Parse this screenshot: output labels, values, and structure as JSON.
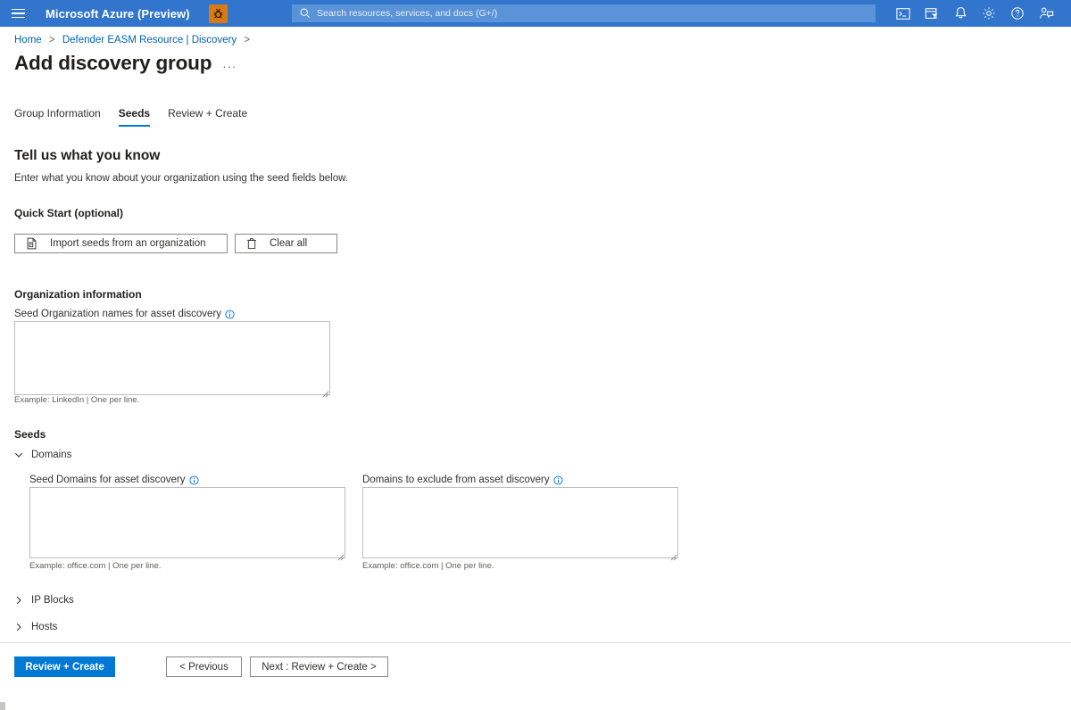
{
  "topbar": {
    "menu_icon": "hamburger-icon",
    "brand": "Microsoft Azure (Preview)",
    "bug_badge_icon": "bug-icon",
    "search": {
      "icon": "search-icon",
      "placeholder": "Search resources, services, and docs (G+/)",
      "value": ""
    },
    "icons": [
      {
        "name": "cloud-shell-icon",
        "label": "Cloud Shell"
      },
      {
        "name": "directory-filter-icon",
        "label": "Directories + subscriptions"
      },
      {
        "name": "notifications-bell-icon",
        "label": "Notifications"
      },
      {
        "name": "settings-gear-icon",
        "label": "Settings"
      },
      {
        "name": "help-question-icon",
        "label": "Help"
      },
      {
        "name": "feedback-icon",
        "label": "Feedback"
      }
    ],
    "colors": {
      "bar": "#3275cc",
      "search_field": "#5b93d8",
      "bug_badge": "#d97b14"
    }
  },
  "breadcrumb": {
    "items": [
      "Home",
      "Defender EASM Resource | Discovery"
    ],
    "separator": ">",
    "trailing_separator": ">"
  },
  "header": {
    "title": "Add discovery group",
    "more_actions": "···"
  },
  "tabs": [
    {
      "label": "Group Information",
      "active": false
    },
    {
      "label": "Seeds",
      "active": true
    },
    {
      "label": "Review + Create",
      "active": false
    }
  ],
  "main": {
    "section_title": "Tell us what you know",
    "section_subtitle": "Enter what you know about your organization using the seed fields below.",
    "quick_start": {
      "heading": "Quick Start (optional)",
      "import_button": {
        "label": "Import seeds from an organization",
        "icon": "import-document-icon"
      },
      "clear_button": {
        "label": "Clear all",
        "icon": "trash-icon"
      }
    },
    "organization": {
      "heading": "Organization information",
      "field": {
        "label": "Seed Organization names for asset discovery",
        "info_icon": "info-icon",
        "value": "",
        "placeholder": "",
        "hint": "Example: LinkedIn | One per line."
      }
    },
    "seeds": {
      "heading": "Seeds",
      "sections": [
        {
          "label": "Domains",
          "expanded": true,
          "icon": "chevron-down-icon"
        },
        {
          "label": "IP Blocks",
          "expanded": false,
          "icon": "chevron-right-icon"
        },
        {
          "label": "Hosts",
          "expanded": false,
          "icon": "chevron-right-icon"
        }
      ],
      "domains": {
        "include": {
          "label": "Seed Domains for asset discovery",
          "info_icon": "info-icon",
          "value": "",
          "placeholder": "",
          "hint": "Example: office.com | One per line."
        },
        "exclude": {
          "label": "Domains to exclude from asset discovery",
          "info_icon": "info-icon",
          "value": "",
          "placeholder": "",
          "hint": "Example: office.com | One per line."
        }
      }
    }
  },
  "footer": {
    "primary": {
      "label": "Review + Create",
      "color": "#0078d4"
    },
    "previous": {
      "label": "< Previous"
    },
    "next": {
      "label": "Next : Review + Create >"
    }
  }
}
